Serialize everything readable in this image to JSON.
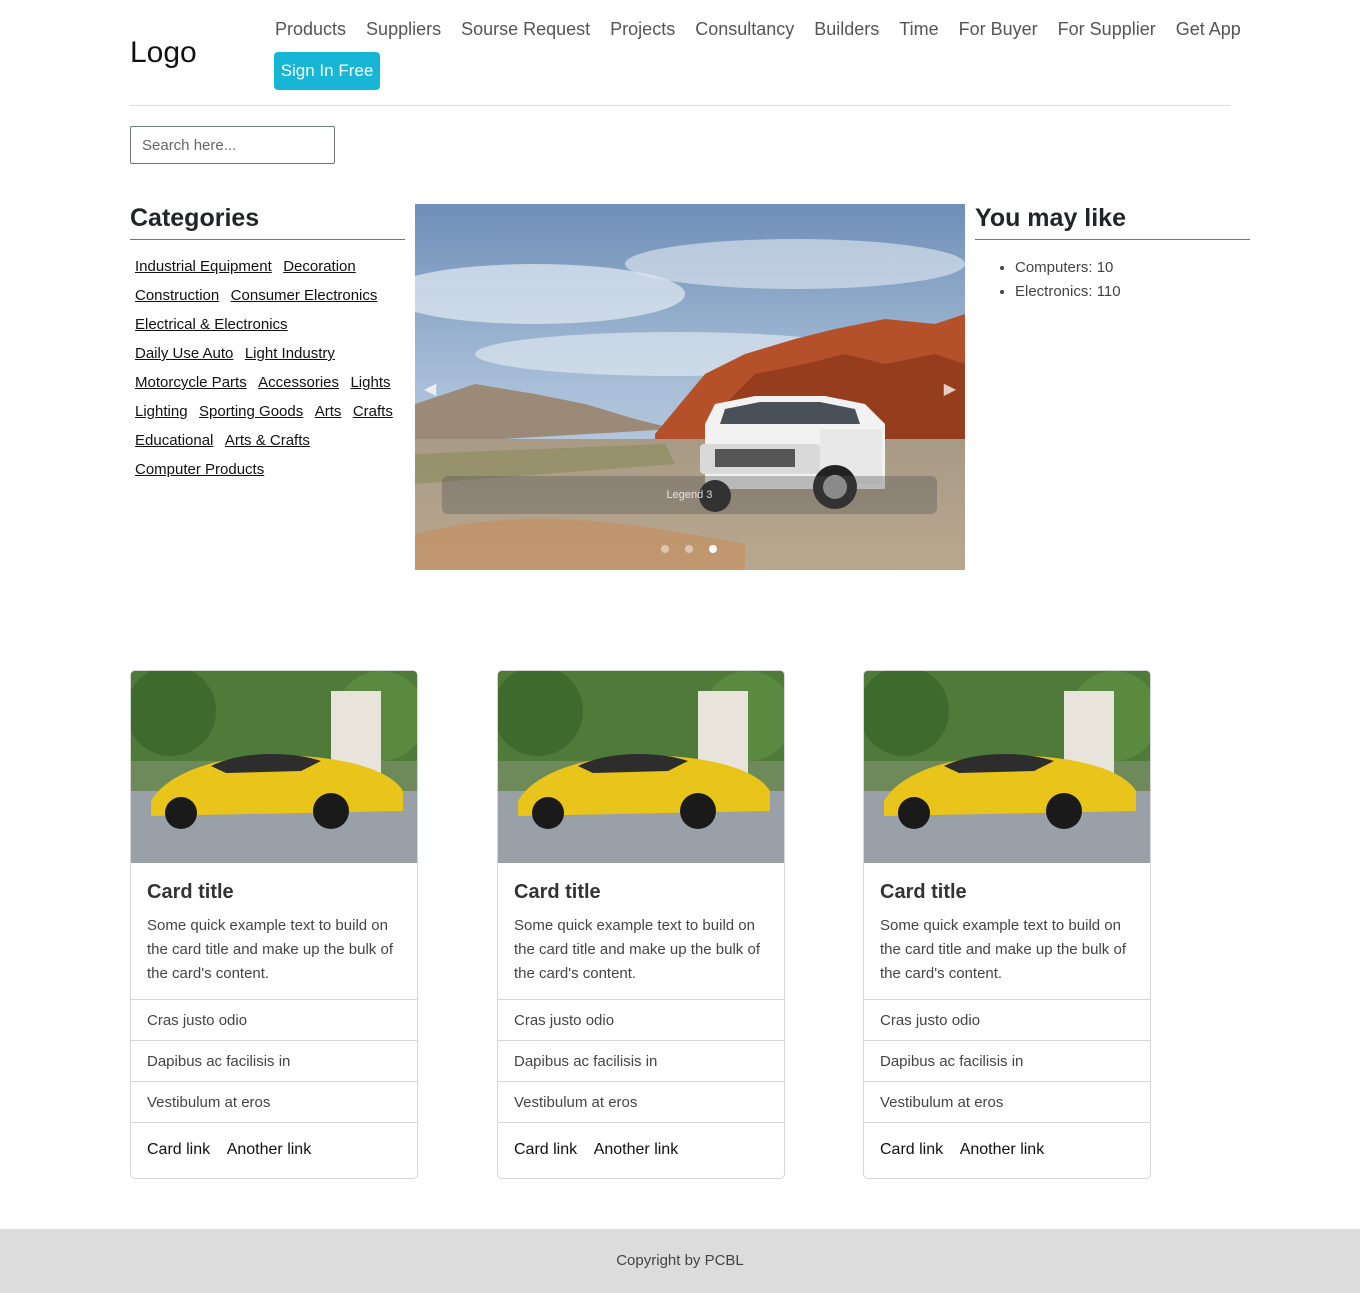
{
  "header": {
    "logo": "Logo",
    "nav": [
      "Products",
      "Suppliers",
      "Sourse Request",
      "Projects",
      "Consultancy",
      "Builders",
      "Time",
      "For Buyer",
      "For Supplier",
      "Get App"
    ],
    "signin_label": "Sign In Free"
  },
  "search": {
    "placeholder": "Search here...",
    "value": ""
  },
  "categories": {
    "title": "Categories",
    "rows": [
      [
        "Industrial Equipment",
        "Decoration"
      ],
      [
        "Construction",
        "Consumer Electronics"
      ],
      [
        "Electrical & Electronics"
      ],
      [
        "Daily Use Auto",
        "Light Industry"
      ],
      [
        "Motorcycle Parts",
        "Accessories",
        "Lights"
      ],
      [
        "Lighting",
        "Sporting Goods",
        "Arts",
        "Crafts"
      ],
      [
        "Educational",
        "Arts & Crafts"
      ],
      [
        "Computer Products"
      ]
    ]
  },
  "carousel": {
    "caption": "Legend 3",
    "slides": 3,
    "active_slide": 3,
    "prev_icon": "chevron-left-icon",
    "next_icon": "chevron-right-icon"
  },
  "you_may_like": {
    "title": "You may like",
    "items": [
      "Computers: 10",
      "Electronics: 110"
    ]
  },
  "cards": [
    {
      "title": "Card title",
      "text": "Some quick example text to build on the card title and make up the bulk of the card's content.",
      "items": [
        "Cras justo odio",
        "Dapibus ac facilisis in",
        "Vestibulum at eros"
      ],
      "links": [
        "Card link",
        "Another link"
      ]
    },
    {
      "title": "Card title",
      "text": "Some quick example text to build on the card title and make up the bulk of the card's content.",
      "items": [
        "Cras justo odio",
        "Dapibus ac facilisis in",
        "Vestibulum at eros"
      ],
      "links": [
        "Card link",
        "Another link"
      ]
    },
    {
      "title": "Card title",
      "text": "Some quick example text to build on the card title and make up the bulk of the card's content.",
      "items": [
        "Cras justo odio",
        "Dapibus ac facilisis in",
        "Vestibulum at eros"
      ],
      "links": [
        "Card link",
        "Another link"
      ]
    }
  ],
  "footer": {
    "text": "Copyright by PCBL"
  },
  "colors": {
    "accent": "#17b6d6",
    "footer_bg": "#dcdcdc"
  }
}
